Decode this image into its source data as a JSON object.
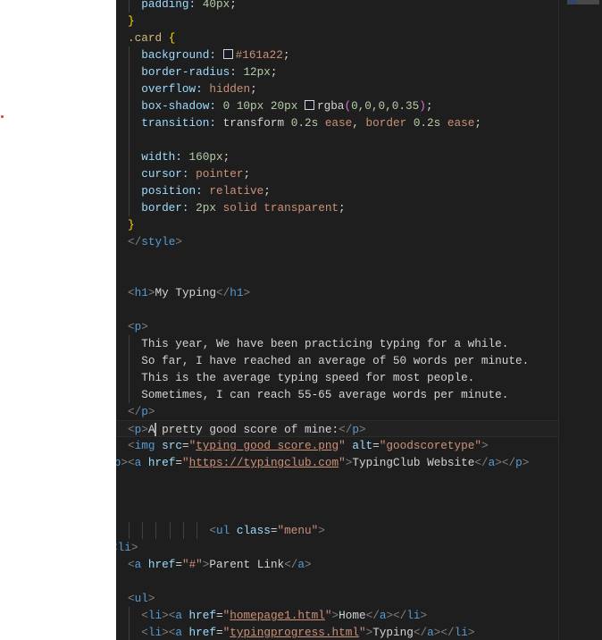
{
  "editor": {
    "lines": [
      [
        [
          "  padding: ",
          "prop"
        ],
        [
          "40px",
          "num"
        ],
        [
          ";",
          "pun"
        ]
      ],
      [
        [
          "}",
          "brace"
        ]
      ],
      [
        [
          ".card ",
          "sel"
        ],
        [
          "{",
          "brace"
        ]
      ],
      [
        [
          "  background: ",
          "prop"
        ],
        [
          "#swatch",
          "swatch"
        ],
        [
          "#161a22",
          "val"
        ],
        [
          ";",
          "pun"
        ]
      ],
      [
        [
          "  border-radius: ",
          "prop"
        ],
        [
          "12px",
          "num"
        ],
        [
          ";",
          "pun"
        ]
      ],
      [
        [
          "  overflow: ",
          "prop"
        ],
        [
          "hidden",
          "val"
        ],
        [
          ";",
          "pun"
        ]
      ],
      [
        [
          "  box-shadow: ",
          "prop"
        ],
        [
          "0 10px 20px ",
          "num"
        ],
        [
          "#swatch",
          "swatch"
        ],
        [
          "rgba",
          "txt"
        ],
        [
          "(",
          "paren"
        ],
        [
          "0,0,0,0.35",
          "num"
        ],
        [
          ")",
          "paren"
        ],
        [
          ";",
          "pun"
        ]
      ],
      [
        [
          "  transition: ",
          "prop"
        ],
        [
          "transform ",
          "txt"
        ],
        [
          "0.2s ",
          "num"
        ],
        [
          "ease",
          "val"
        ],
        [
          ", ",
          "pun"
        ],
        [
          "border ",
          "val"
        ],
        [
          "0.2s ",
          "num"
        ],
        [
          "ease",
          "val"
        ],
        [
          ";",
          "pun"
        ]
      ],
      [],
      [
        [
          "  width: ",
          "prop"
        ],
        [
          "160px",
          "num"
        ],
        [
          ";",
          "pun"
        ]
      ],
      [
        [
          "  cursor: ",
          "prop"
        ],
        [
          "pointer",
          "val"
        ],
        [
          ";",
          "pun"
        ]
      ],
      [
        [
          "  position: ",
          "prop"
        ],
        [
          "relative",
          "val"
        ],
        [
          ";",
          "pun"
        ]
      ],
      [
        [
          "  border: ",
          "prop"
        ],
        [
          "2px ",
          "num"
        ],
        [
          "solid transparent",
          "val"
        ],
        [
          ";",
          "pun"
        ]
      ],
      [
        [
          "}",
          "brace"
        ]
      ],
      [
        [
          "</",
          "br"
        ],
        [
          "style",
          "tag"
        ],
        [
          ">",
          "br"
        ]
      ],
      [],
      [],
      [
        [
          "<",
          "br"
        ],
        [
          "h1",
          "tag"
        ],
        [
          ">",
          "br"
        ],
        [
          "My Typing",
          "txt"
        ],
        [
          "</",
          "br"
        ],
        [
          "h1",
          "tag"
        ],
        [
          ">",
          "br"
        ]
      ],
      [],
      [
        [
          "<",
          "br"
        ],
        [
          "p",
          "tag"
        ],
        [
          ">",
          "br"
        ]
      ],
      [
        [
          "  This year, We have been practicing typing for a while.",
          "txt"
        ]
      ],
      [
        [
          "  So far, I have reached an average of 50 words per minute.",
          "txt"
        ]
      ],
      [
        [
          "  This is the average typing speed for most people.",
          "txt"
        ]
      ],
      [
        [
          "  Sometimes, I can reach 55-65 average words per minute.",
          "txt"
        ]
      ],
      [
        [
          "</",
          "br"
        ],
        [
          "p",
          "tag"
        ],
        [
          ">",
          "br"
        ]
      ],
      [
        [
          "<",
          "br"
        ],
        [
          "p",
          "tag"
        ],
        [
          ">",
          "br"
        ],
        [
          "A",
          "txt"
        ],
        [
          "#cursor",
          "cursor"
        ],
        [
          " pretty good score of mine:",
          "txt"
        ],
        [
          "</",
          "br"
        ],
        [
          "p",
          "tag"
        ],
        [
          ">",
          "br"
        ]
      ],
      [
        [
          "<",
          "br"
        ],
        [
          "img ",
          "tag"
        ],
        [
          "src",
          "attr"
        ],
        [
          "=",
          "pun"
        ],
        [
          "\"",
          "str"
        ],
        [
          "typing good score.png",
          "link"
        ],
        [
          "\" ",
          "str"
        ],
        [
          "alt",
          "attr"
        ],
        [
          "=",
          "pun"
        ],
        [
          "\"goodscoretype\"",
          "str"
        ],
        [
          ">",
          "br"
        ]
      ],
      [
        [
          "<",
          "br"
        ],
        [
          "p",
          "tag"
        ],
        [
          "><",
          "br"
        ],
        [
          "a ",
          "tag"
        ],
        [
          "href",
          "attr"
        ],
        [
          "=",
          "pun"
        ],
        [
          "\"",
          "str"
        ],
        [
          "https://typingclub.com",
          "link"
        ],
        [
          "\"",
          "str"
        ],
        [
          ">",
          "br"
        ],
        [
          "TypingClub Website",
          "txt"
        ],
        [
          "</",
          "br"
        ],
        [
          "a",
          "tag"
        ],
        [
          "></",
          "br"
        ],
        [
          "p",
          "tag"
        ],
        [
          ">",
          "br"
        ]
      ],
      [],
      [],
      [],
      [
        [
          "            <",
          "br"
        ],
        [
          "ul ",
          "tag"
        ],
        [
          "class",
          "attr"
        ],
        [
          "=",
          "pun"
        ],
        [
          "\"menu\"",
          "str"
        ],
        [
          ">",
          "br"
        ]
      ],
      [
        [
          "<",
          "br"
        ],
        [
          "li",
          "tag"
        ],
        [
          ">",
          "br"
        ]
      ],
      [
        [
          "<",
          "br"
        ],
        [
          "a ",
          "tag"
        ],
        [
          "href",
          "attr"
        ],
        [
          "=",
          "pun"
        ],
        [
          "\"#\"",
          "str"
        ],
        [
          ">",
          "br"
        ],
        [
          "Parent Link",
          "txt"
        ],
        [
          "</",
          "br"
        ],
        [
          "a",
          "tag"
        ],
        [
          ">",
          "br"
        ]
      ],
      [],
      [
        [
          "<",
          "br"
        ],
        [
          "ul",
          "tag"
        ],
        [
          ">",
          "br"
        ]
      ],
      [
        [
          "  <",
          "br"
        ],
        [
          "li",
          "tag"
        ],
        [
          "><",
          "br"
        ],
        [
          "a ",
          "tag"
        ],
        [
          "href",
          "attr"
        ],
        [
          "=",
          "pun"
        ],
        [
          "\"",
          "str"
        ],
        [
          "homepage1.html",
          "link"
        ],
        [
          "\"",
          "str"
        ],
        [
          ">",
          "br"
        ],
        [
          "Home",
          "txt"
        ],
        [
          "</",
          "br"
        ],
        [
          "a",
          "tag"
        ],
        [
          "></",
          "br"
        ],
        [
          "li",
          "tag"
        ],
        [
          ">",
          "br"
        ]
      ],
      [
        [
          "  <",
          "br"
        ],
        [
          "li",
          "tag"
        ],
        [
          "><",
          "br"
        ],
        [
          "a ",
          "tag"
        ],
        [
          "href",
          "attr"
        ],
        [
          "=",
          "pun"
        ],
        [
          "\"",
          "str"
        ],
        [
          "typingprogress.html",
          "link"
        ],
        [
          "\"",
          "str"
        ],
        [
          ">",
          "br"
        ],
        [
          "Typing",
          "txt"
        ],
        [
          "</",
          "br"
        ],
        [
          "a",
          "tag"
        ],
        [
          "></",
          "br"
        ],
        [
          "li",
          "tag"
        ],
        [
          ">",
          "br"
        ]
      ]
    ]
  }
}
